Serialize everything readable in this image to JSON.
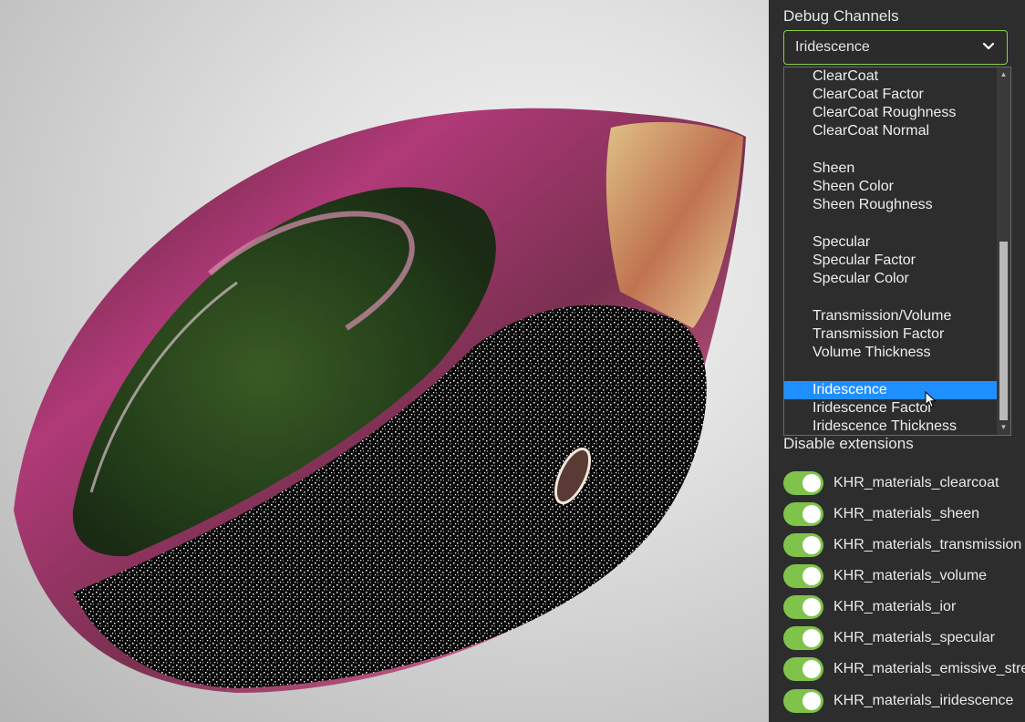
{
  "debug_channels": {
    "title": "Debug Channels",
    "selected_value": "Iridescence",
    "options": [
      {
        "label": "ClearCoat",
        "selected": false
      },
      {
        "label": "ClearCoat Factor",
        "selected": false
      },
      {
        "label": "ClearCoat Roughness",
        "selected": false
      },
      {
        "label": "ClearCoat Normal",
        "selected": false
      },
      {
        "label": "",
        "selected": false
      },
      {
        "label": "Sheen",
        "selected": false
      },
      {
        "label": "Sheen Color",
        "selected": false
      },
      {
        "label": "Sheen Roughness",
        "selected": false
      },
      {
        "label": "",
        "selected": false
      },
      {
        "label": "Specular",
        "selected": false
      },
      {
        "label": "Specular Factor",
        "selected": false
      },
      {
        "label": "Specular Color",
        "selected": false
      },
      {
        "label": "",
        "selected": false
      },
      {
        "label": "Transmission/Volume",
        "selected": false
      },
      {
        "label": "Transmission Factor",
        "selected": false
      },
      {
        "label": "Volume Thickness",
        "selected": false
      },
      {
        "label": "",
        "selected": false
      },
      {
        "label": "Iridescence",
        "selected": true
      },
      {
        "label": "Iridescence Factor",
        "selected": false
      },
      {
        "label": "Iridescence Thickness",
        "selected": false
      }
    ]
  },
  "disable_extensions": {
    "title": "Disable extensions",
    "items": [
      {
        "label": "KHR_materials_clearcoat",
        "enabled": true
      },
      {
        "label": "KHR_materials_sheen",
        "enabled": true
      },
      {
        "label": "KHR_materials_transmission",
        "enabled": true
      },
      {
        "label": "KHR_materials_volume",
        "enabled": true
      },
      {
        "label": "KHR_materials_ior",
        "enabled": true
      },
      {
        "label": "KHR_materials_specular",
        "enabled": true
      },
      {
        "label": "KHR_materials_emissive_strength",
        "enabled": true
      },
      {
        "label": "KHR_materials_iridescence",
        "enabled": true
      }
    ]
  },
  "colors": {
    "panel_bg": "#2d2d2d",
    "accent_green": "#7fc34a",
    "selection_blue": "#1f8fff"
  },
  "icons": {
    "dropdown": "chevron-down-icon",
    "cursor": "mouse-pointer-icon"
  }
}
